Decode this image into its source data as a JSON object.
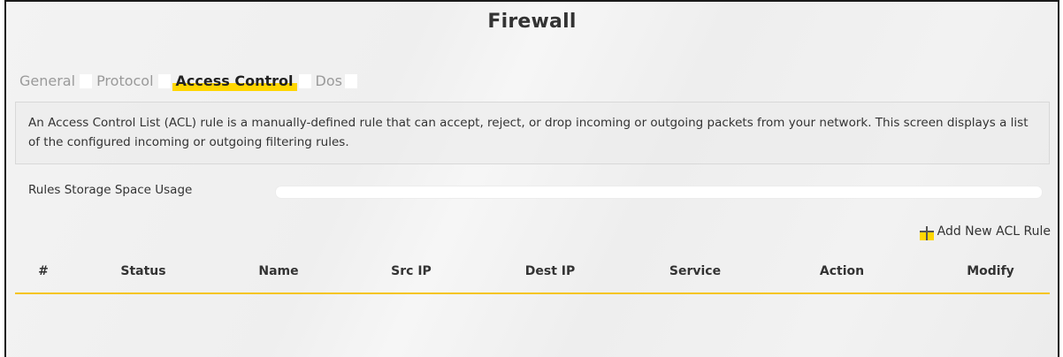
{
  "page": {
    "title": "Firewall"
  },
  "tabs": [
    {
      "label": "General",
      "active": false
    },
    {
      "label": "Protocol",
      "active": false
    },
    {
      "label": "Access Control",
      "active": true
    },
    {
      "label": "Dos",
      "active": false
    }
  ],
  "description": "An Access Control List (ACL) rule is a manually-defined rule that can accept, reject, or drop incoming or outgoing packets from your network. This screen displays a list of the configured incoming or outgoing filtering rules.",
  "usage": {
    "label": "Rules Storage Space Usage",
    "fill_fraction": 0
  },
  "actions": {
    "add_rule_label": "Add New ACL Rule",
    "add_icon": "plus-icon"
  },
  "table": {
    "columns": [
      "#",
      "Status",
      "Name",
      "Src IP",
      "Dest IP",
      "Service",
      "Action",
      "Modify"
    ],
    "rows": []
  },
  "colors": {
    "accent": "#ffd600",
    "divider": "#f5c518",
    "text": "#333333",
    "tab_inactive": "#9a9a9a"
  }
}
